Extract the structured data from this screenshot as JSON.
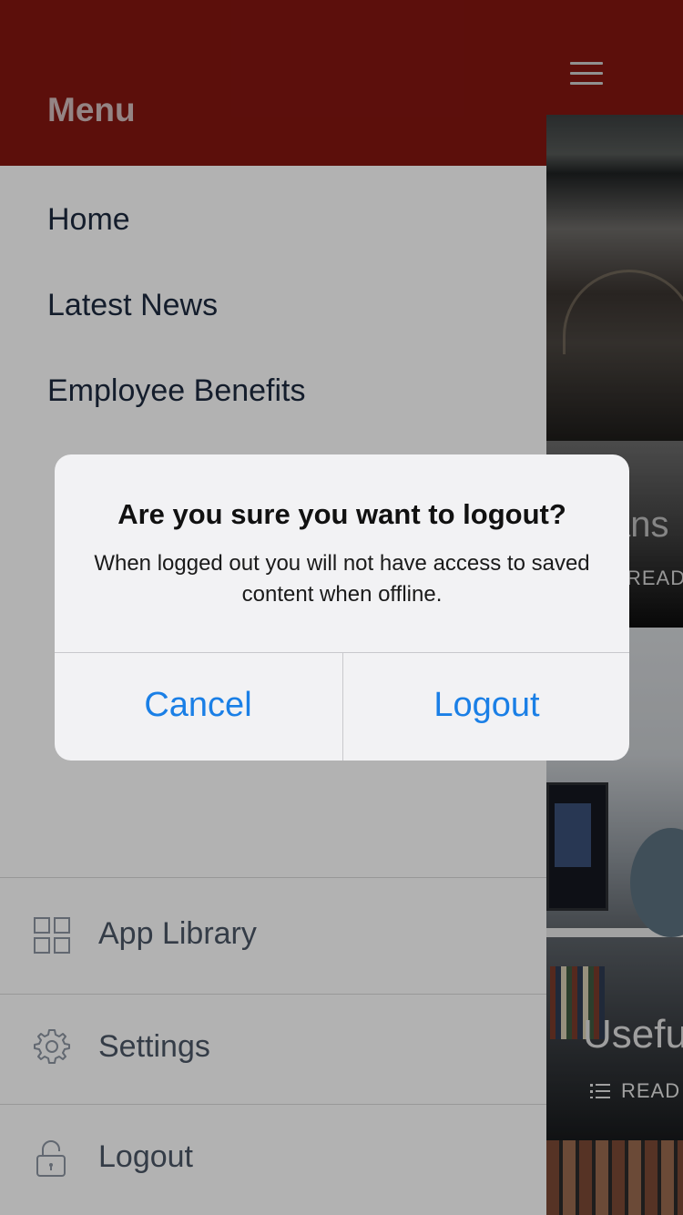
{
  "drawer": {
    "title": "Menu",
    "items": [
      {
        "label": "Home"
      },
      {
        "label": "Latest News"
      },
      {
        "label": "Employee Benefits"
      }
    ],
    "bottom": [
      {
        "label": "App Library",
        "icon": "grid-icon"
      },
      {
        "label": "Settings",
        "icon": "gear-icon"
      },
      {
        "label": "Logout",
        "icon": "padlock-icon"
      }
    ]
  },
  "content": {
    "card1_title": "ans",
    "card1_read": "READ",
    "card2_title": "Usefu",
    "card2_read": "READ"
  },
  "dialog": {
    "title": "Are you sure you want to logout?",
    "message": "When logged out you will not have access to saved content when offline.",
    "cancel_label": "Cancel",
    "confirm_label": "Logout"
  },
  "colors": {
    "header_red": "#841611",
    "dialog_button_blue": "#1a7fe6"
  }
}
